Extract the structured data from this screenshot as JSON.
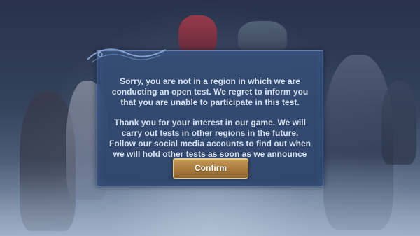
{
  "dialog": {
    "paragraphs": [
      "Sorry, you are not in a region in which we are conducting an open test. We regret to inform you that you are unable to participate in this test.",
      "Thank you for your interest in our game. We will carry out tests in other regions in the future. Follow our social media accounts to find out when we will hold other tests as soon as we announce them!"
    ],
    "confirm_label": "Confirm"
  },
  "colors": {
    "dialog_background": "#364e76",
    "dialog_border": "#5f7fb3",
    "button_gold": "#c79a57",
    "text": "#d5e0ef"
  }
}
